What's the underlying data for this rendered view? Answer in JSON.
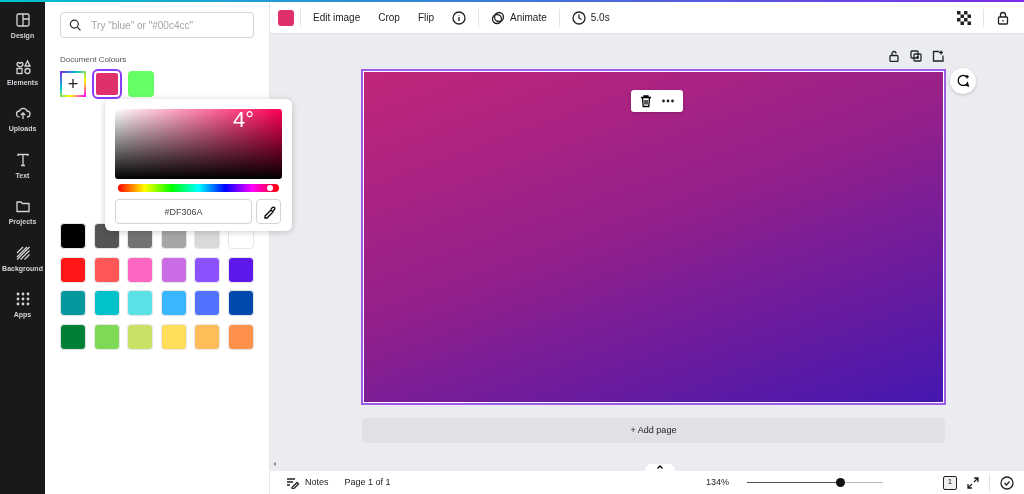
{
  "sidebar": {
    "items": [
      {
        "label": "Design",
        "kind": "design",
        "selected": false
      },
      {
        "label": "Elements",
        "kind": "elements",
        "selected": false
      },
      {
        "label": "Uploads",
        "kind": "uploads",
        "selected": false
      },
      {
        "label": "Text",
        "kind": "text",
        "selected": false
      },
      {
        "label": "Projects",
        "kind": "projects",
        "selected": false
      },
      {
        "label": "Background",
        "kind": "background",
        "selected": false
      },
      {
        "label": "Apps",
        "kind": "apps",
        "selected": false
      }
    ]
  },
  "panel": {
    "search": {
      "placeholder": "Try \"blue\" or \"#00c4cc\""
    },
    "document_colours_title": "Document Colours",
    "document_colours": [
      {
        "kind": "add",
        "label": "+",
        "selected": false
      },
      {
        "kind": "swatch",
        "color": "#df306a",
        "selected": true
      },
      {
        "kind": "swatch",
        "color": "#66ff66",
        "selected": false
      }
    ],
    "color_picker": {
      "overlay_text": "4°",
      "hue": {
        "level": 0.945
      },
      "hex_value": "#DF306A"
    },
    "default_colours": [
      {
        "color": "#000000"
      },
      {
        "color": "#545454"
      },
      {
        "color": "#737373"
      },
      {
        "color": "#a6a6a6"
      },
      {
        "color": "#d9d9d9"
      },
      {
        "color": "#ffffff"
      },
      {
        "color": "#ff1616"
      },
      {
        "color": "#ff5757"
      },
      {
        "color": "#ff66c4"
      },
      {
        "color": "#cb6ce6"
      },
      {
        "color": "#8c52ff"
      },
      {
        "color": "#5e17eb"
      },
      {
        "color": "#03989e"
      },
      {
        "color": "#00c2cb"
      },
      {
        "color": "#5ce1e6"
      },
      {
        "color": "#38b6ff"
      },
      {
        "color": "#5271ff"
      },
      {
        "color": "#004aad"
      },
      {
        "color": "#008037"
      },
      {
        "color": "#7ed957"
      },
      {
        "color": "#c9e265"
      },
      {
        "color": "#ffde59"
      },
      {
        "color": "#ffbd59"
      },
      {
        "color": "#ff914d"
      }
    ]
  },
  "toolbar": {
    "color_button": {
      "color": "#df306a"
    },
    "buttons": [
      {
        "kind": "text",
        "label": "Edit image"
      },
      {
        "kind": "text",
        "label": "Crop"
      },
      {
        "kind": "text",
        "label": "Flip"
      },
      {
        "kind": "info"
      },
      {
        "kind": "animate",
        "label": "Animate"
      },
      {
        "kind": "timing",
        "label": "5.0s"
      }
    ]
  },
  "canvas": {
    "add_page": "+ Add page"
  },
  "status_bar": {
    "notes": "Notes",
    "page": "Page 1 of 1",
    "zoom": "134%",
    "zoom_slider": {
      "level": 0.69
    },
    "page_count": "1"
  }
}
